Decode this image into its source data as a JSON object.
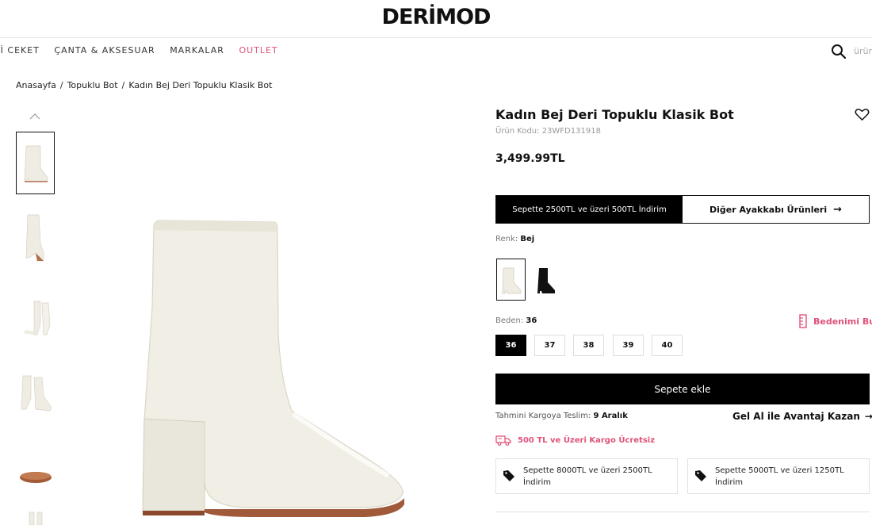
{
  "header": {
    "logo": "DERİMOD"
  },
  "nav": {
    "items": [
      "Rİ CEKET",
      "ÇANTA & AKSESUAR",
      "MARKALAR",
      "OUTLET"
    ],
    "search_placeholder": "ürün"
  },
  "breadcrumb": [
    "Anasayfa",
    "Topuklu Bot",
    "Kadın Bej Deri Topuklu Klasik Bot"
  ],
  "product": {
    "title": "Kadın Bej Deri Topuklu Klasik Bot",
    "code": "Ürün Kodu: 23WFD131918",
    "price": "3,499.99TL"
  },
  "promo": {
    "discount": "Sepette 2500TL ve üzeri 500TL İndirim",
    "other_products": "Diğer Ayakkabı Ürünleri",
    "arrow": "→"
  },
  "color": {
    "label": "Renk:",
    "value": "Bej",
    "options": [
      "Bej",
      "Siyah"
    ]
  },
  "size": {
    "label": "Beden:",
    "value": "36",
    "guide": "Bedenimi Bul",
    "options": [
      "36",
      "37",
      "38",
      "39",
      "40"
    ]
  },
  "cart": {
    "add_label": "Sepete ekle"
  },
  "delivery": {
    "label": "Tahmini Kargoya Teslim:",
    "date": "9 Aralık",
    "gelal": "Gel Al ile Avantaj Kazan",
    "arrow": "→"
  },
  "shipping": {
    "text": "500 TL ve Üzeri Kargo Ücretsiz"
  },
  "coupons": [
    "Sepette 8000TL ve üzeri 2500TL İndirim",
    "Sepette 5000TL ve üzeri 1250TL İndirim"
  ],
  "colors": {
    "accent": "#e0537a",
    "primary": "#000000",
    "boot": "#efece3"
  }
}
